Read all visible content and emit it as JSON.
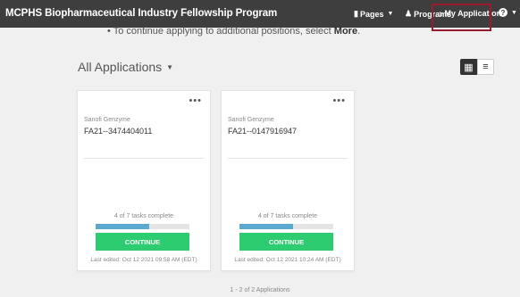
{
  "header": {
    "title": "MCPHS Biopharmaceutical Industry Fellowship Program",
    "nav": [
      {
        "label": "Pages",
        "icon": "document-icon"
      },
      {
        "label": "Programs",
        "icon": "users-icon"
      },
      {
        "label": "My Applications",
        "icon": "home-icon"
      }
    ],
    "help_symbol": "?"
  },
  "instruction": {
    "prefix": "To continue applying to additional positions, select ",
    "emphasis": "More",
    "suffix": "."
  },
  "section": {
    "title": "All Applications"
  },
  "applications": [
    {
      "organization": "Sanofi Genzyme",
      "id": "FA21--3474404011",
      "progress_text": "4 of 7 tasks complete",
      "tasks_complete": 4,
      "tasks_total": 7,
      "button_label": "CONTINUE",
      "last_edited": "Last edited: Oct 12 2021 09:58 AM (EDT)"
    },
    {
      "organization": "Sanofi Genzyme",
      "id": "FA21--0147916947",
      "progress_text": "4 of 7 tasks complete",
      "tasks_complete": 4,
      "tasks_total": 7,
      "button_label": "CONTINUE",
      "last_edited": "Last edited: Oct 12 2021 10:24 AM (EDT)"
    }
  ],
  "footer": {
    "count_text": "1 - 2 of 2 Applications"
  },
  "colors": {
    "topbar": "#3e3e3e",
    "highlight": "#9b1b2e",
    "continue": "#2ecc71",
    "progress": "#5aa9d0"
  }
}
